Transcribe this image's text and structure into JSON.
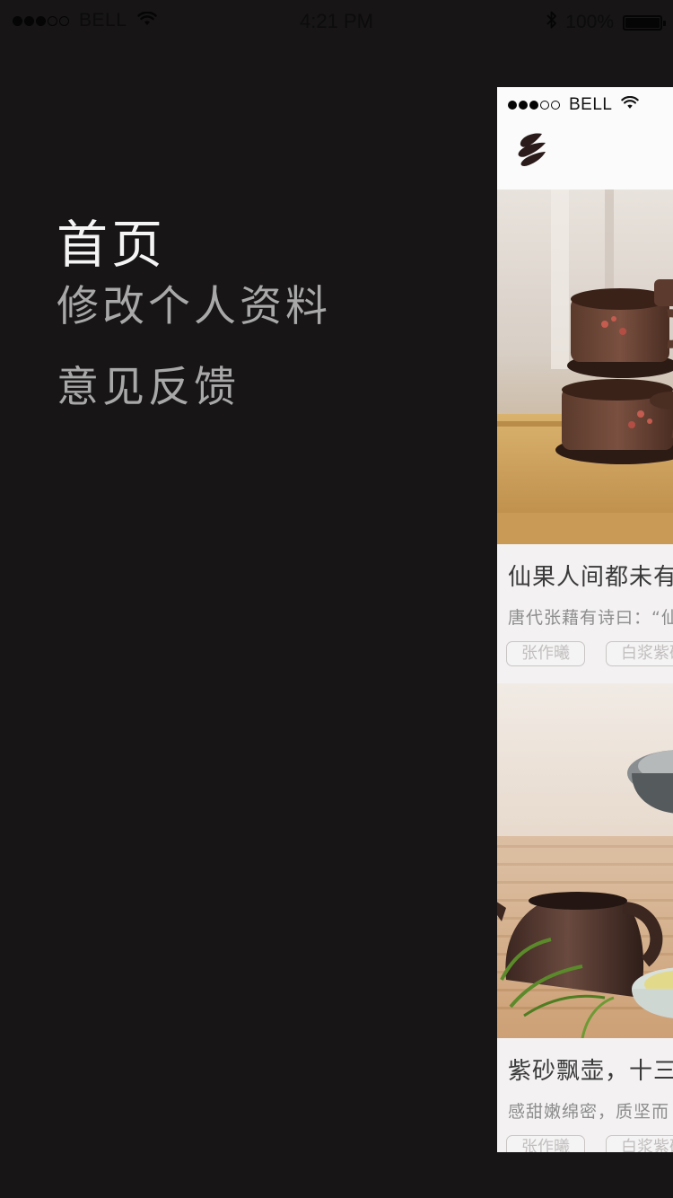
{
  "status_bar": {
    "signal_dots": [
      true,
      true,
      true,
      false,
      false
    ],
    "carrier": "BELL",
    "time": "4:21 PM",
    "battery_percent": "100%",
    "battery_level": 1.0,
    "icons": [
      "wifi-icon",
      "bluetooth-icon",
      "battery-icon"
    ]
  },
  "side_menu": {
    "items": [
      {
        "label": "首页",
        "active": true
      },
      {
        "label": "修改个人资料",
        "active": false
      },
      {
        "label": "意见反馈",
        "active": false
      }
    ]
  },
  "content_panel": {
    "status_bar": {
      "carrier": "BELL",
      "signal_dots": [
        true,
        true,
        true,
        false,
        false
      ]
    },
    "nav": {
      "logo_icon": "tea-leaf-logo-icon"
    },
    "articles": [
      {
        "title": "仙果人间都未有",
        "excerpt": "唐代张藉有诗曰：“仙",
        "tags": [
          "张作曦",
          "白浆紫砂"
        ],
        "image": "purple-clay-teacups-on-tray"
      },
      {
        "title": "紫砂飘壶，十三",
        "excerpt": "感甜嫩绵密，质坚而",
        "tags": [
          "张作曦",
          "白浆紫砂"
        ],
        "image": "purple-clay-pitcher-and-cups"
      }
    ]
  },
  "colors": {
    "background": "#171516",
    "menu_active": "#f4f4f4",
    "menu_inactive": "#a8a8a8",
    "panel_bg": "#f3f1f1",
    "logo": "#2b1c1b"
  }
}
